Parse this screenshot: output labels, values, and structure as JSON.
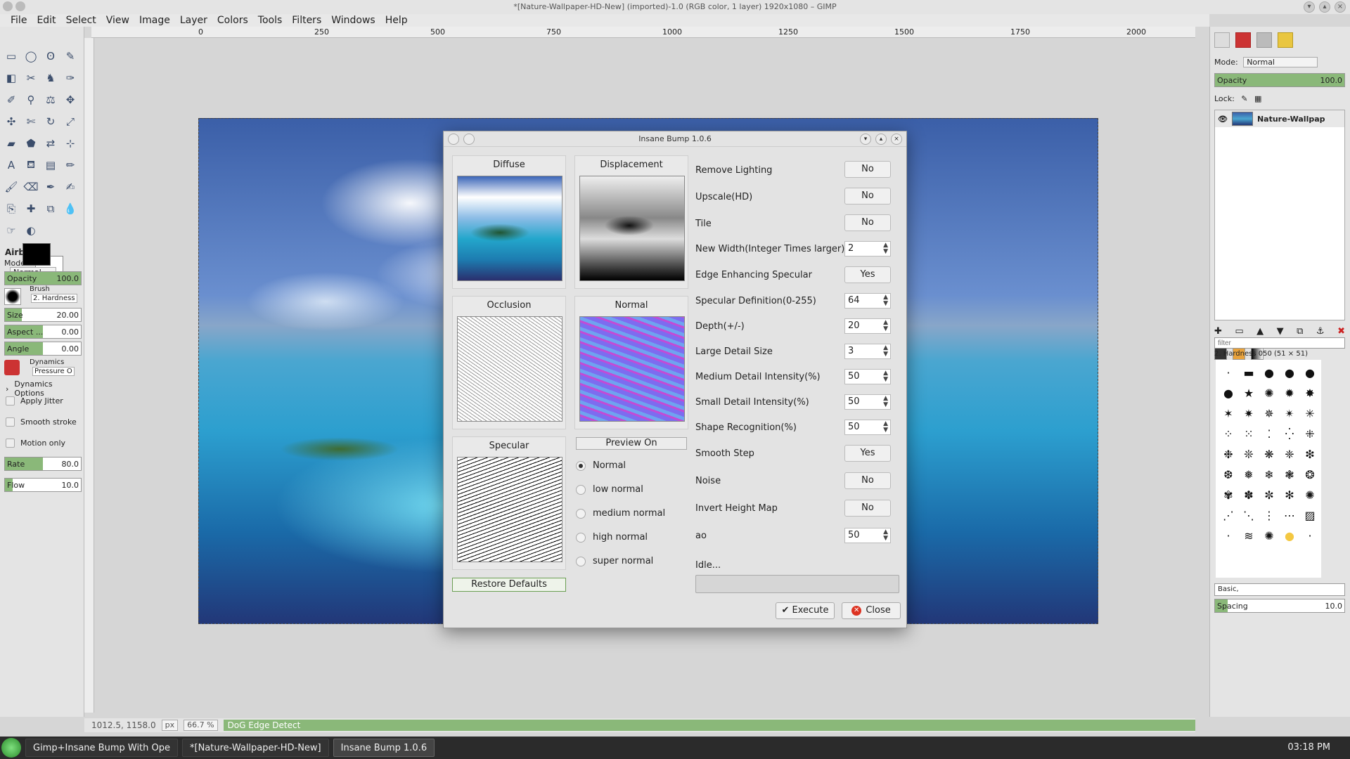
{
  "window": {
    "title": "*[Nature-Wallpaper-HD-New] (imported)-1.0 (RGB color, 1 layer) 1920x1080 – GIMP"
  },
  "menu": [
    "File",
    "Edit",
    "Select",
    "View",
    "Image",
    "Layer",
    "Colors",
    "Tools",
    "Filters",
    "Windows",
    "Help"
  ],
  "ruler": {
    "ticks": [
      "0",
      "250",
      "500",
      "750",
      "1000",
      "1250",
      "1500",
      "1750",
      "2000"
    ]
  },
  "tool_options": {
    "tool_name": "Airbrush",
    "mode_label": "Mode:",
    "mode_value": "Normal",
    "opacity_label": "Opacity",
    "opacity_value": "100.0",
    "brush_label": "Brush",
    "brush_value": "2. Hardness",
    "size_label": "Size",
    "size_value": "20.00",
    "aspect_label": "Aspect ...",
    "aspect_value": "0.00",
    "angle_label": "Angle",
    "angle_value": "0.00",
    "dynamics_label": "Dynamics",
    "dynamics_value": "Pressure O",
    "dynamics_options": "Dynamics Options",
    "apply_jitter": "Apply Jitter",
    "smooth_stroke": "Smooth stroke",
    "motion_only": "Motion only",
    "rate_label": "Rate",
    "rate_value": "80.0",
    "flow_label": "Flow",
    "flow_value": "10.0"
  },
  "layers": {
    "mode_label": "Mode:",
    "mode_value": "Normal",
    "opacity_label": "Opacity",
    "opacity_value": "100.0",
    "lock_label": "Lock:",
    "layer_name": "Nature-Wallpap"
  },
  "brushes": {
    "filter_placeholder": "filter",
    "brush_title": "2. Hardness 050 (51 × 51)",
    "tag": "Basic,",
    "spacing_label": "Spacing",
    "spacing_value": "10.0"
  },
  "status": {
    "coords": "1012.5, 1158.0",
    "unit": "px",
    "zoom": "66.7 %",
    "message": "DoG Edge Detect"
  },
  "taskbar": {
    "tasks": [
      "Gimp+Insane Bump With Ope",
      "*[Nature-Wallpaper-HD-New]",
      "Insane Bump 1.0.6"
    ],
    "clock": "03:18 PM"
  },
  "dialog": {
    "title": "Insane Bump 1.0.6",
    "previews": {
      "diffuse": "Diffuse",
      "displacement": "Displacement",
      "occlusion": "Occlusion",
      "normal": "Normal",
      "specular": "Specular"
    },
    "preview_on": "Preview On",
    "radios": [
      "Normal",
      "low normal",
      "medium normal",
      "high normal",
      "super normal"
    ],
    "restore_defaults": "Restore Defaults",
    "params": {
      "remove_lighting": {
        "label": "Remove Lighting",
        "value": "No"
      },
      "upscale": {
        "label": "Upscale(HD)",
        "value": "No"
      },
      "tile": {
        "label": "Tile",
        "value": "No"
      },
      "new_width": {
        "label": "New Width(Integer Times larger)",
        "value": "2"
      },
      "edge_spec": {
        "label": "Edge Enhancing Specular",
        "value": "Yes"
      },
      "spec_def": {
        "label": "Specular Definition(0-255)",
        "value": "64"
      },
      "depth": {
        "label": "Depth(+/-)",
        "value": "20"
      },
      "large_detail": {
        "label": "Large Detail Size",
        "value": "3"
      },
      "medium_detail": {
        "label": "Medium Detail Intensity(%)",
        "value": "50"
      },
      "small_detail": {
        "label": "Small Detail Intensity(%)",
        "value": "50"
      },
      "shape_recog": {
        "label": "Shape Recognition(%)",
        "value": "50"
      },
      "smooth_step": {
        "label": "Smooth Step",
        "value": "Yes"
      },
      "noise": {
        "label": "Noise",
        "value": "No"
      },
      "invert_height": {
        "label": "Invert Height Map",
        "value": "No"
      },
      "ao": {
        "label": "ao",
        "value": "50"
      }
    },
    "status_text": "Idle...",
    "execute": "Execute",
    "close": "Close"
  },
  "colors": {
    "accent_green": "#8ab879",
    "dialog_bg": "#e3e3e3",
    "taskbar_bg": "#2b2b2b"
  }
}
